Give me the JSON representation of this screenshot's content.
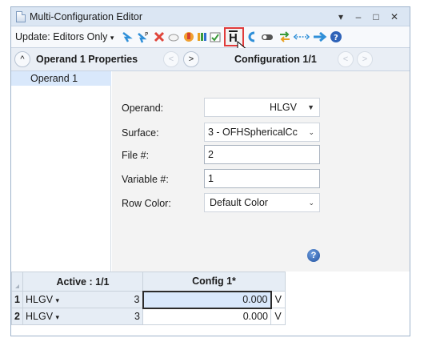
{
  "window": {
    "title": "Multi-Configuration Editor",
    "controls": {
      "menu": "▾",
      "minimize": "–",
      "maximize": "□",
      "close": "✕"
    }
  },
  "toolbar": {
    "update_label": "Update: Editors Only",
    "update_caret": "▾",
    "icons": [
      "insert-config-icon",
      "insert-operand-icon",
      "delete-operand-icon",
      "clear-icon",
      "make-thermal-icon",
      "tile-icon",
      "show-hide-icon",
      "hide-properties-icon",
      "shortcut-icon",
      "toggle-icon",
      "swap-icon",
      "expand-icon",
      "go-icon",
      "help-icon"
    ],
    "highlighted_button_glyph": "H",
    "highlight_color": "#e03b3b"
  },
  "properties_header": {
    "collapse_glyph": "^",
    "title": "Operand  1 Properties",
    "prev_glyph": "<",
    "next_glyph": ">",
    "config_title": "Configuration 1/1"
  },
  "left_list": {
    "selected_item": "Operand 1"
  },
  "properties": {
    "operand_label": "Operand:",
    "operand_value": "HLGV",
    "surface_label": "Surface:",
    "surface_value": "3 - OFHSphericalCc",
    "file_label": "File #:",
    "file_value": "2",
    "variable_label": "Variable #:",
    "variable_value": "1",
    "row_color_label": "Row Color:",
    "row_color_value": "Default Color",
    "help_glyph": "?"
  },
  "grid": {
    "headers": {
      "active": "Active : 1/1",
      "config": "Config 1*"
    },
    "rows": [
      {
        "num": "1",
        "operand": "HLGV",
        "caret": "▾",
        "param": "3",
        "value": "0.000",
        "solve": "V"
      },
      {
        "num": "2",
        "operand": "HLGV",
        "caret": "▾",
        "param": "3",
        "value": "0.000",
        "solve": "V"
      }
    ]
  },
  "colors": {
    "selection": "#d9e8fb",
    "title_bar": "#dbe6f3",
    "accent": "#2f6fd0"
  }
}
